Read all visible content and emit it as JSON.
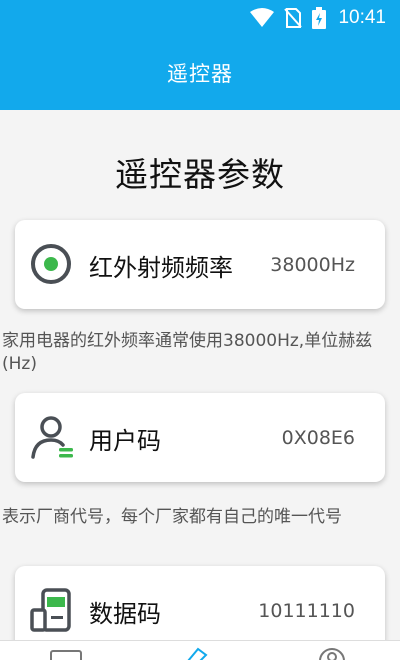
{
  "status_bar": {
    "time": "10:41",
    "icons": [
      "wifi-icon",
      "no-sim-icon",
      "battery-charging-icon"
    ]
  },
  "app_bar": {
    "title": "遥控器"
  },
  "page_title": "遥控器参数",
  "colors": {
    "primary": "#12a9ec",
    "green": "#3cb84c",
    "icon_dark": "#4a4f55"
  },
  "cards": [
    {
      "icon": "radio-target-icon",
      "label": "红外射频频率",
      "value": "38000Hz",
      "description": "家用电器的红外频率通常使用38000Hz,单位赫兹(Hz)"
    },
    {
      "icon": "user-icon",
      "label": "用户码",
      "value": "0X08E6",
      "description": "表示厂商代号，每个厂家都有自己的唯一代号"
    },
    {
      "icon": "data-device-icon",
      "label": "数据码",
      "value": "10111110"
    }
  ],
  "bottom_nav": {
    "items": [
      "remote-tab-icon",
      "edit-tab-icon",
      "profile-tab-icon"
    ]
  }
}
